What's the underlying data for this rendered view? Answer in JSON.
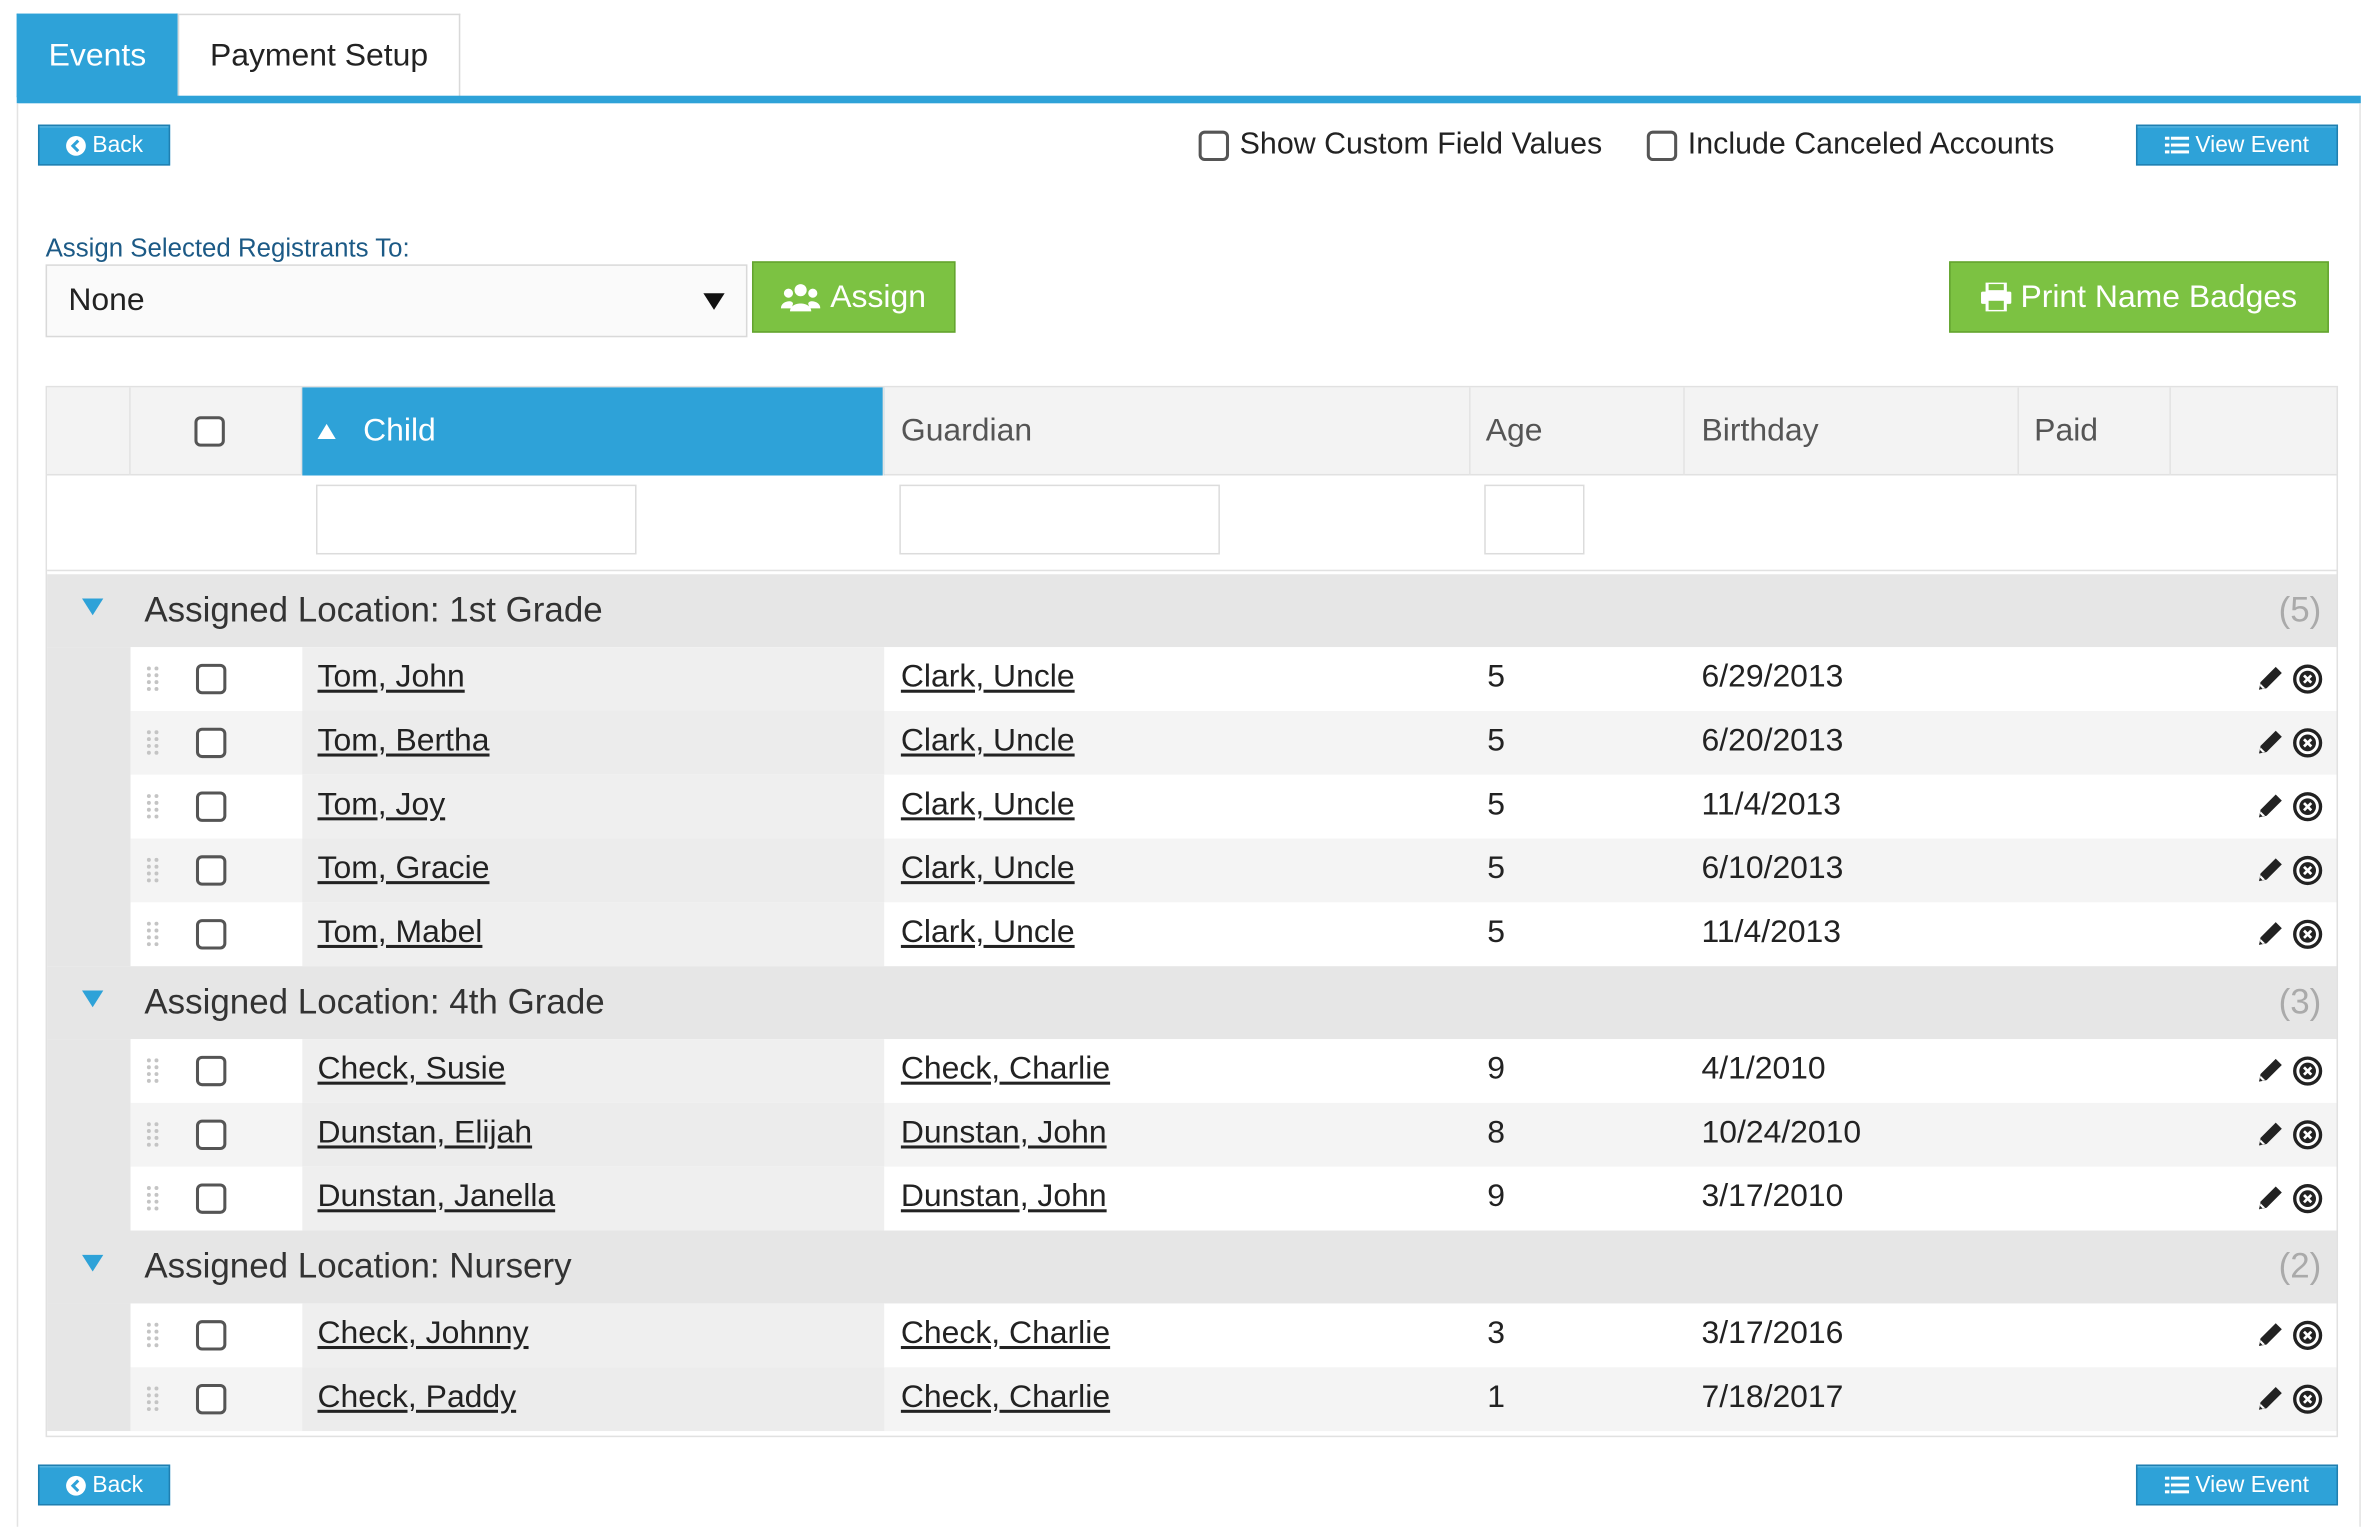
{
  "tabs": [
    {
      "label": "Events",
      "active": true
    },
    {
      "label": "Payment Setup",
      "active": false
    }
  ],
  "toolbar": {
    "back_label": "Back",
    "show_custom_fields_label": "Show Custom Field Values",
    "include_canceled_label": "Include Canceled Accounts",
    "view_event_label": "View Event"
  },
  "assign": {
    "label": "Assign Selected Registrants To:",
    "selected_value": "None",
    "button_label": "Assign"
  },
  "print_badges_label": "Print Name Badges",
  "grid": {
    "columns": [
      {
        "key": "child",
        "label": "Child",
        "sorted": "asc"
      },
      {
        "key": "guardian",
        "label": "Guardian"
      },
      {
        "key": "age",
        "label": "Age"
      },
      {
        "key": "birthday",
        "label": "Birthday"
      },
      {
        "key": "paid",
        "label": "Paid"
      }
    ],
    "groups": [
      {
        "title": "Assigned Location: 1st Grade",
        "count": "(5)",
        "rows": [
          {
            "child": "Tom, John",
            "guardian": "Clark, Uncle",
            "age": "5",
            "birthday": "6/29/2013"
          },
          {
            "child": "Tom, Bertha",
            "guardian": "Clark, Uncle",
            "age": "5",
            "birthday": "6/20/2013"
          },
          {
            "child": "Tom, Joy",
            "guardian": "Clark, Uncle",
            "age": "5",
            "birthday": "11/4/2013"
          },
          {
            "child": "Tom, Gracie",
            "guardian": "Clark, Uncle",
            "age": "5",
            "birthday": "6/10/2013"
          },
          {
            "child": "Tom, Mabel",
            "guardian": "Clark, Uncle",
            "age": "5",
            "birthday": "11/4/2013"
          }
        ]
      },
      {
        "title": "Assigned Location: 4th Grade",
        "count": "(3)",
        "rows": [
          {
            "child": "Check, Susie",
            "guardian": "Check, Charlie",
            "age": "9",
            "birthday": "4/1/2010"
          },
          {
            "child": "Dunstan, Elijah",
            "guardian": "Dunstan, John",
            "age": "8",
            "birthday": "10/24/2010"
          },
          {
            "child": "Dunstan, Janella",
            "guardian": "Dunstan, John",
            "age": "9",
            "birthday": "3/17/2010"
          }
        ]
      },
      {
        "title": "Assigned Location: Nursery",
        "count": "(2)",
        "rows": [
          {
            "child": "Check, Johnny",
            "guardian": "Check, Charlie",
            "age": "3",
            "birthday": "3/17/2016"
          },
          {
            "child": "Check, Paddy",
            "guardian": "Check, Charlie",
            "age": "1",
            "birthday": "7/18/2017"
          }
        ]
      }
    ]
  },
  "icons": {
    "back": "circle-arrow-left-icon",
    "view_event": "list-icon",
    "assign": "users-icon",
    "print": "printer-icon",
    "edit": "pencil-icon",
    "delete": "circle-x-icon",
    "drag": "drag-handle-icon"
  },
  "colors": {
    "primary_blue": "#2ea2d8",
    "green": "#7cc242",
    "group_bg": "#e6e6e6"
  }
}
